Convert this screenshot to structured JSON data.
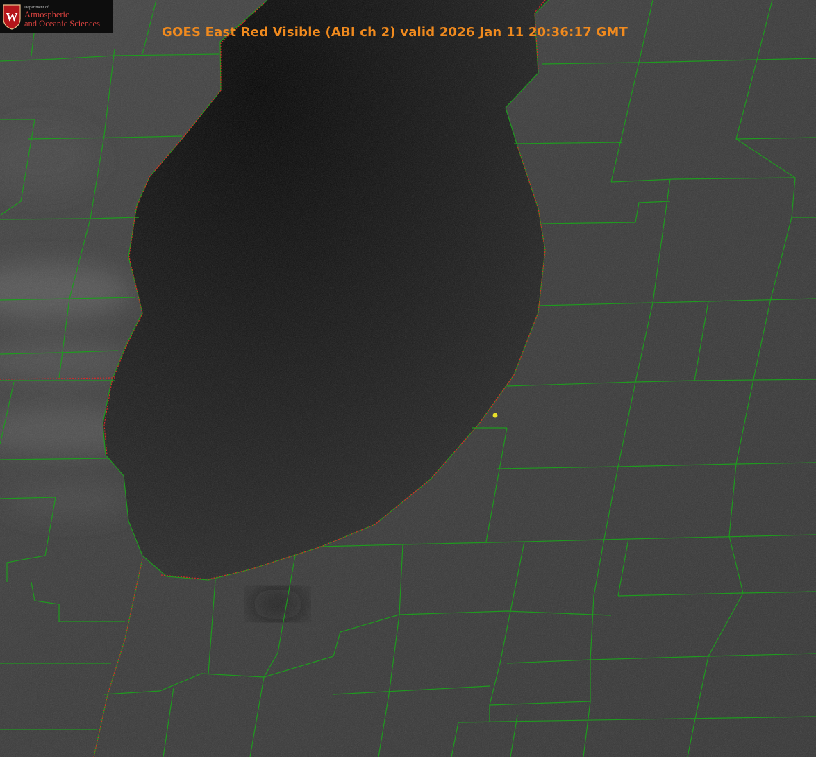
{
  "logo": {
    "crest_letter": "W",
    "department_label": "Department of",
    "name_line1": "Atmospheric",
    "name_line2": "and Oceanic Sciences",
    "crest_color": "#b5161b",
    "text_color": "#d8423f"
  },
  "title": {
    "text": "GOES East Red Visible (ABI ch 2) valid 2026 Jan 11 20:36:17 GMT",
    "color": "#f08a1e"
  },
  "map": {
    "imagery": "satellite-visible-grayscale",
    "land_color": "#3b3b3b",
    "lake_color": "#0e0e0e",
    "county_border_color": "#1f9a1f",
    "state_border_color": "#d42a2a",
    "marker_color": "#e8e02a"
  }
}
